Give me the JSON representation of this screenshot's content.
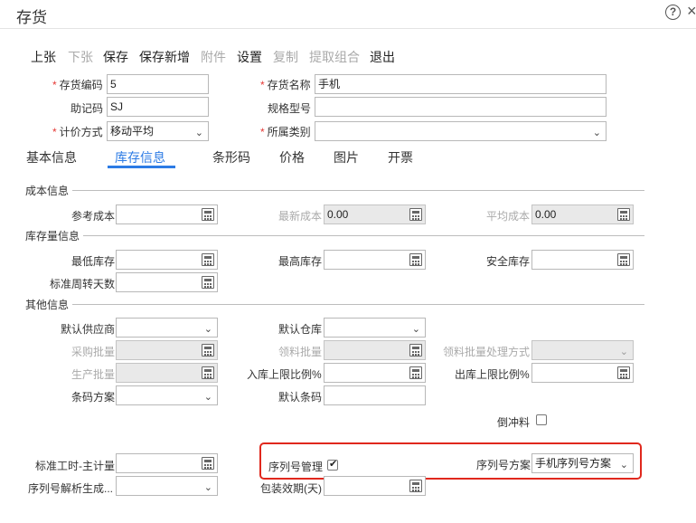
{
  "window": {
    "title": "存货",
    "help_icon": "?"
  },
  "toolbar": {
    "prev": "上张",
    "next": "下张",
    "save": "保存",
    "save_new": "保存新增",
    "attachment": "附件",
    "settings": "设置",
    "copy": "复制",
    "extract": "提取组合",
    "exit": "退出"
  },
  "form": {
    "code_label": "存货编码",
    "code_value": "5",
    "name_label": "存货名称",
    "name_value": "手机",
    "mnemonic_label": "助记码",
    "mnemonic_value": "SJ",
    "spec_label": "规格型号",
    "spec_value": "",
    "valuation_label": "计价方式",
    "valuation_value": "移动平均",
    "category_label": "所属类别",
    "category_value": ""
  },
  "tabs": [
    "基本信息",
    "库存信息",
    "条形码",
    "价格",
    "图片",
    "开票"
  ],
  "sections": {
    "cost": {
      "title": "成本信息",
      "ref_cost": "参考成本",
      "ref_cost_value": "",
      "latest_cost": "最新成本",
      "latest_cost_value": "0.00",
      "avg_cost": "平均成本",
      "avg_cost_value": "0.00"
    },
    "stock": {
      "title": "库存量信息",
      "min": "最低库存",
      "max": "最高库存",
      "safe": "安全库存",
      "turnover": "标准周转天数"
    },
    "other": {
      "title": "其他信息",
      "supplier": "默认供应商",
      "warehouse": "默认仓库",
      "purchase_batch": "采购批量",
      "pick_batch": "领料批量",
      "pick_batch_method": "领料批量处理方式",
      "production_batch": "生产批量",
      "inbound_limit": "入库上限比例%",
      "outbound_limit": "出库上限比例%",
      "barcode_scheme": "条码方案",
      "default_barcode": "默认条码",
      "backflush": "倒冲料",
      "std_hours": "标准工时-主计量",
      "serial_mgmt": "序列号管理",
      "serial_scheme": "序列号方案",
      "serial_scheme_value": "手机序列号方案",
      "serial_parse": "序列号解析生成...",
      "shelf_life": "包装效期(天)"
    }
  }
}
